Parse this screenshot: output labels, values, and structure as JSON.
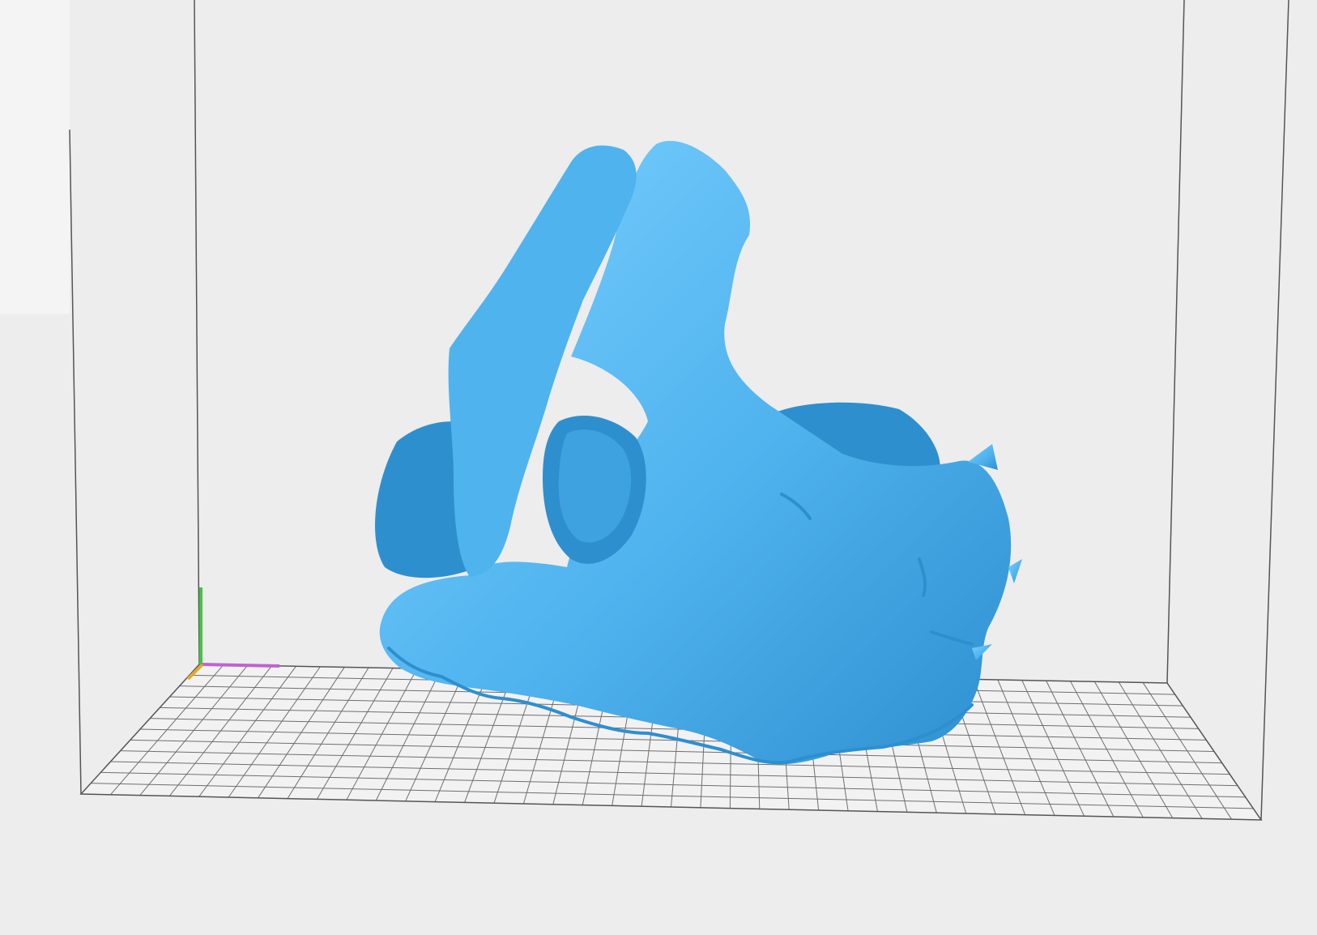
{
  "viewport": {
    "background": "#ededed",
    "background_top_left": "#f4f4f4",
    "build_volume_edge_color": "#555555",
    "bed_grid_line_color": "#6f6f6f",
    "bed_fill_color": "#f2f2f2"
  },
  "axes_gizmo": {
    "x_color": "#c062d2",
    "y_color": "#e4a829",
    "z_color": "#48c048"
  },
  "model": {
    "name": "bone-fragment-model",
    "color": "#4fb3ee",
    "shade_color": "#2e8fcf",
    "highlight_color": "#7cd0ff"
  }
}
